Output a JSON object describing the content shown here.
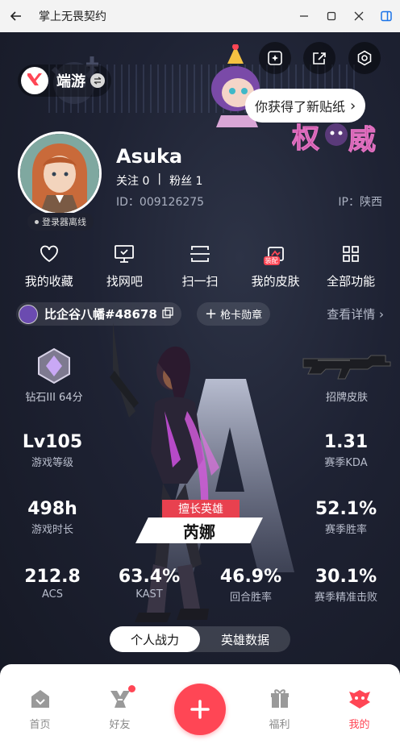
{
  "window": {
    "title": "掌上无畏契约"
  },
  "brand": {
    "name": "端游"
  },
  "sticker_notice": {
    "text": "你获得了新贴纸"
  },
  "profile": {
    "username": "Asuka",
    "follow_label": "关注",
    "follow_count": "0",
    "fans_label": "粉丝",
    "fans_count": "1",
    "separator": "|",
    "id_text": "ID：009126275",
    "ip_text": "IP：陕西",
    "online_status": "登录器离线"
  },
  "actions": [
    {
      "label": "我的收藏",
      "icon": "heart-icon"
    },
    {
      "label": "找网吧",
      "icon": "monitor-icon"
    },
    {
      "label": "扫一扫",
      "icon": "scan-icon"
    },
    {
      "label": "我的皮肤",
      "icon": "skin-icon",
      "badge": "装配"
    },
    {
      "label": "全部功能",
      "icon": "grid-icon"
    }
  ],
  "player": {
    "name": "比企谷八幡#48678",
    "card_badge": "枪卡勋章",
    "details": "查看详情"
  },
  "rank": {
    "label": "钻石III 64分"
  },
  "signature_skin": {
    "label": "招牌皮肤"
  },
  "stats": {
    "level": {
      "value": "Lv105",
      "label": "游戏等级"
    },
    "kda": {
      "value": "1.31",
      "label": "赛季KDA"
    },
    "hours": {
      "value": "498h",
      "label": "游戏时长"
    },
    "winrate": {
      "value": "52.1%",
      "label": "赛季胜率"
    },
    "acs": {
      "value": "212.8",
      "label": "ACS"
    },
    "kast": {
      "value": "63.4%",
      "label": "KAST"
    },
    "round_win": {
      "value": "46.9%",
      "label": "回合胜率"
    },
    "headshot": {
      "value": "30.1%",
      "label": "赛季精准击败"
    }
  },
  "favorite_agent": {
    "tag": "擅长英雄",
    "name": "芮娜"
  },
  "tabs": [
    "个人战力",
    "英雄数据"
  ],
  "nav": {
    "home": "首页",
    "friends": "好友",
    "welfare": "福利",
    "me": "我的"
  },
  "colors": {
    "accent": "#ff4655",
    "background": "#1a1d2b"
  }
}
